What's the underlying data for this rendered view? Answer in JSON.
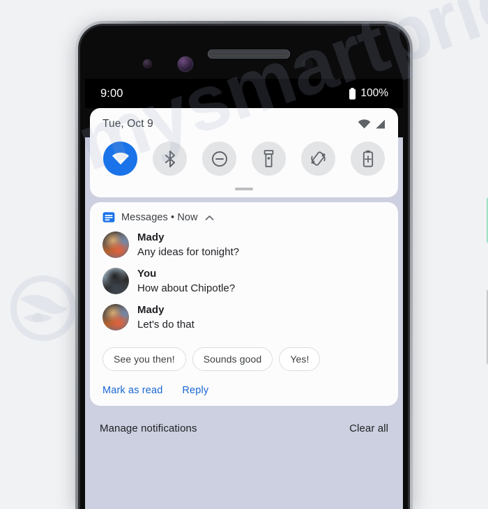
{
  "watermark": {
    "text": "mysmartprice",
    "logo_icon": "mysmartprice-logo-icon"
  },
  "device": {
    "hardware": {
      "proximity_sensor": "proximity-sensor",
      "front_camera": "front-camera",
      "earpiece_speaker": "earpiece-speaker-grille",
      "ambient_sensor": "ambient-light-sensor",
      "power_button": "power-button",
      "volume_button": "volume-rocker"
    }
  },
  "status_bar": {
    "time": "9:00",
    "battery_percent": "100%",
    "battery_icon": "battery-full-icon"
  },
  "quick_settings": {
    "date": "Tue, Oct 9",
    "status_icons": [
      {
        "name": "wifi-icon"
      },
      {
        "name": "cellular-signal-icon"
      }
    ],
    "tiles": [
      {
        "name": "wifi-tile",
        "icon": "wifi-icon",
        "active": true
      },
      {
        "name": "bluetooth-tile",
        "icon": "bluetooth-icon",
        "active": false
      },
      {
        "name": "do-not-disturb-tile",
        "icon": "do-not-disturb-icon",
        "active": false
      },
      {
        "name": "flashlight-tile",
        "icon": "flashlight-icon",
        "active": false
      },
      {
        "name": "auto-rotate-tile",
        "icon": "auto-rotate-icon",
        "active": false
      },
      {
        "name": "battery-saver-tile",
        "icon": "battery-saver-icon",
        "active": false
      }
    ],
    "drag_handle": "quick-settings-drag-handle",
    "accent_color": "#1a73e8",
    "tile_inactive_color": "#e3e4e6"
  },
  "notification": {
    "app_icon": "messages-app-icon",
    "app_name": "Messages • Now",
    "collapse_icon": "chevron-up-icon",
    "messages": [
      {
        "sender": "Mady",
        "text": "Any ideas for tonight?",
        "avatar": "mady"
      },
      {
        "sender": "You",
        "text": "How about Chipotle?",
        "avatar": "you"
      },
      {
        "sender": "Mady",
        "text": "Let's do that",
        "avatar": "mady"
      }
    ],
    "smart_replies": [
      "See you then!",
      "Sounds good",
      "Yes!"
    ],
    "actions": [
      {
        "label": "Mark as read"
      },
      {
        "label": "Reply"
      }
    ],
    "link_color": "#1967d2"
  },
  "manage_bar": {
    "manage_label": "Manage notifications",
    "clear_label": "Clear all",
    "background_color": "#ccd0e0"
  }
}
